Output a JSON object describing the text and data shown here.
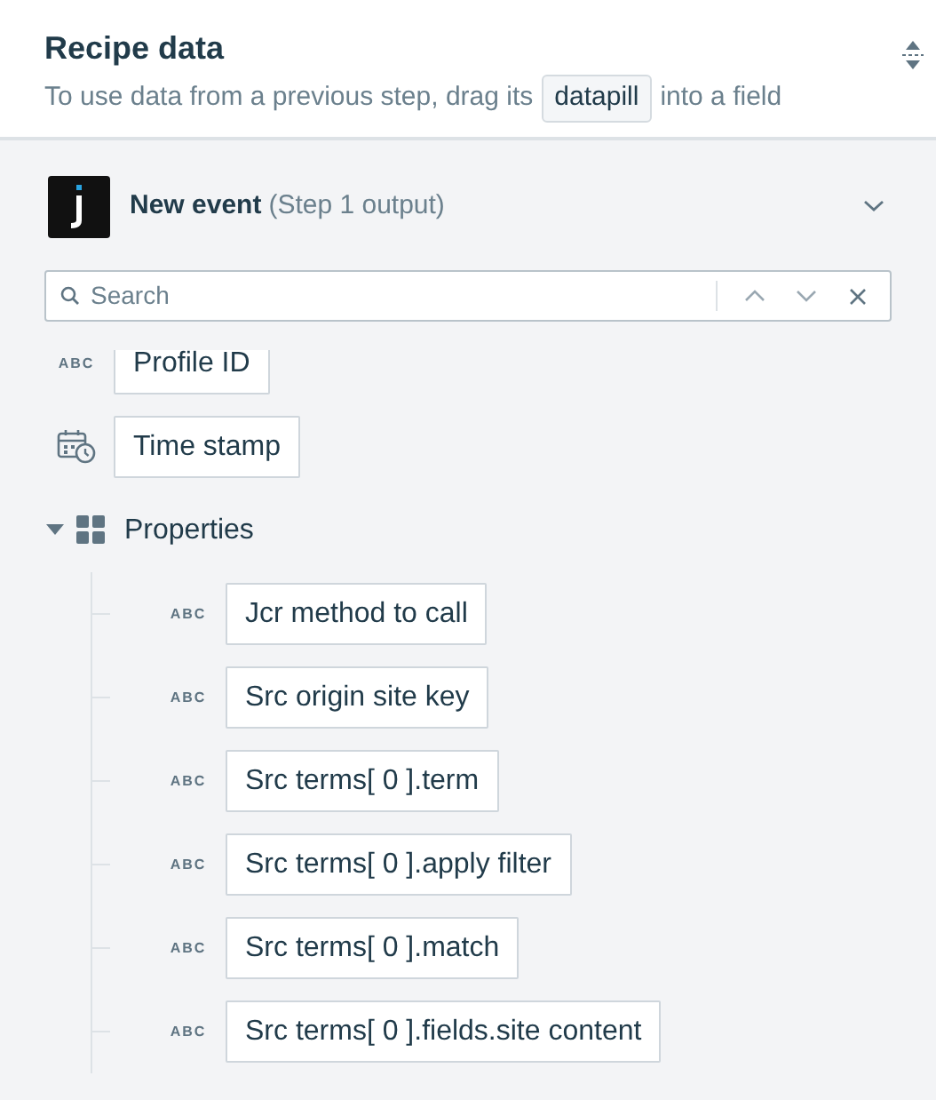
{
  "header": {
    "title": "Recipe data",
    "hint_before": "To use data from a previous step, drag its",
    "hint_pill": "datapill",
    "hint_after": "into a field"
  },
  "step": {
    "title": "New event",
    "subtitle": "(Step 1 output)",
    "expanded": true
  },
  "search": {
    "placeholder": "Search"
  },
  "fields": [
    {
      "kind": "text",
      "type_badge": "ABC",
      "label": "Profile ID"
    },
    {
      "kind": "date",
      "label": "Time stamp"
    },
    {
      "kind": "object",
      "label": "Properties",
      "expanded": true,
      "children": [
        {
          "kind": "text",
          "type_badge": "ABC",
          "label": "Jcr method to call"
        },
        {
          "kind": "text",
          "type_badge": "ABC",
          "label": "Src origin site key"
        },
        {
          "kind": "text",
          "type_badge": "ABC",
          "label": "Src terms[ 0 ].term"
        },
        {
          "kind": "text",
          "type_badge": "ABC",
          "label": "Src terms[ 0 ].apply filter"
        },
        {
          "kind": "text",
          "type_badge": "ABC",
          "label": "Src terms[ 0 ].match"
        },
        {
          "kind": "text",
          "type_badge": "ABC",
          "label": "Src terms[ 0 ].fields.site content"
        }
      ]
    }
  ]
}
